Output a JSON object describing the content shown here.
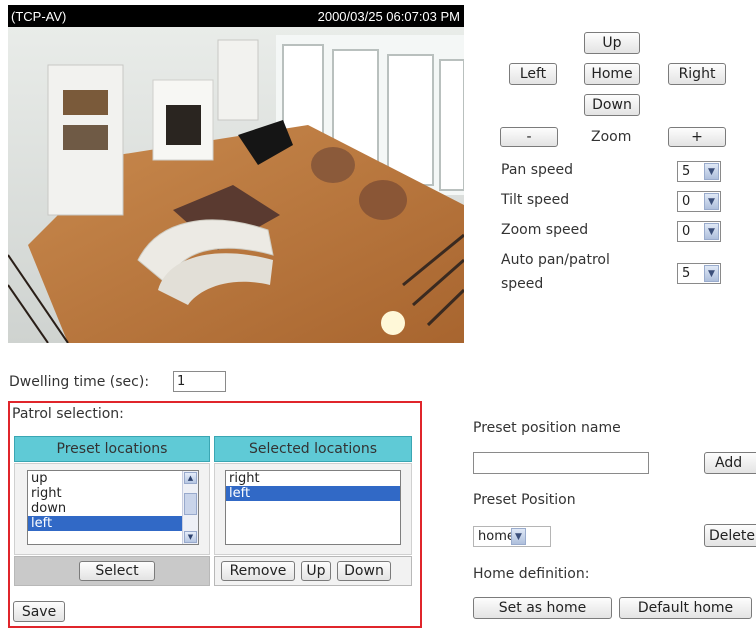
{
  "video": {
    "camera_name": "(TCP-AV)",
    "timestamp": "2000/03/25 06:07:03 PM"
  },
  "ptz": {
    "up": "Up",
    "left": "Left",
    "home": "Home",
    "right": "Right",
    "down": "Down",
    "zoom_out": "-",
    "zoom_label": "Zoom",
    "zoom_in": "+"
  },
  "speeds": {
    "pan_label": "Pan speed",
    "pan_value": "5",
    "tilt_label": "Tilt speed",
    "tilt_value": "0",
    "zoom_label": "Zoom speed",
    "zoom_value": "0",
    "auto_label_line1": "Auto pan/patrol",
    "auto_label_line2": "speed",
    "auto_value": "5"
  },
  "dwelling": {
    "label": "Dwelling time (sec):",
    "value": "1"
  },
  "patrol": {
    "title": "Patrol selection:",
    "preset_header": "Preset locations",
    "selected_header": "Selected locations",
    "preset_items": [
      "up",
      "right",
      "down",
      "left"
    ],
    "preset_selected_index": 3,
    "selected_items": [
      "right",
      "left"
    ],
    "selected_selected_index": 1,
    "select_button": "Select",
    "remove_button": "Remove",
    "up_button": "Up",
    "down_button": "Down",
    "save_button": "Save"
  },
  "preset": {
    "name_label": "Preset position name",
    "name_value": "",
    "add_button": "Add",
    "position_label": "Preset Position",
    "position_value": "home",
    "delete_button": "Delete",
    "home_def_label": "Home definition:",
    "set_home_button": "Set as home",
    "default_home_button": "Default home"
  },
  "colors": {
    "header_teal": "#5fcad6",
    "selection_blue": "#3169c6",
    "patrol_border_red": "#e0252b"
  }
}
